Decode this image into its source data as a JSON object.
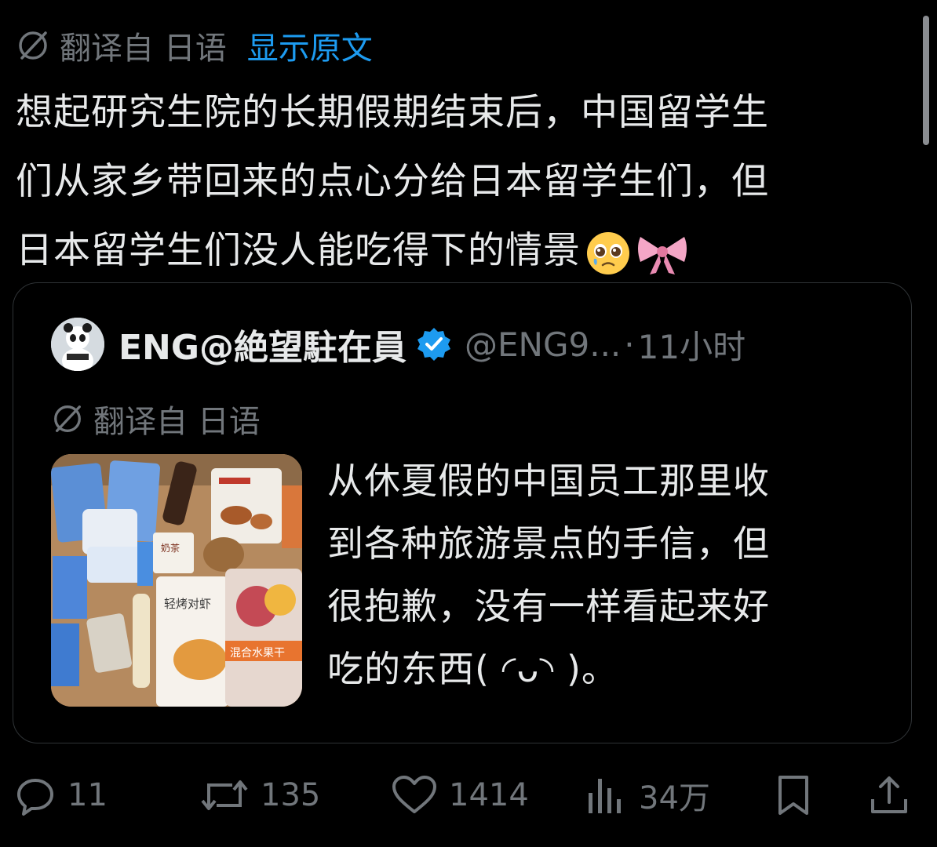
{
  "translation": {
    "label": "翻译自 日语",
    "show_original": "显示原文"
  },
  "tweet": {
    "text_lines": [
      "想起研究生院的长期假期结束后，中国留学生",
      "们从家乡带回来的点心分给日本留学生们，但",
      "日本留学生们没人能吃得下的情景"
    ],
    "emojis": [
      "pleading-face",
      "ribbon-bow"
    ]
  },
  "quote": {
    "author_name": "ENG@絶望駐在員",
    "handle": "@ENG9...",
    "separator": "·",
    "time": "11小时",
    "translation_label": "翻译自 日语",
    "text_lines": [
      "从休夏假的中国员工那里收",
      "到各种旅游景点的手信，但",
      "很抱歉，没有一样看起来好",
      "吃的东西( ◜ᴗ◝ )。"
    ],
    "thumbnail_labels": [
      "轻烤对虾",
      "混合水果干",
      "奶茶"
    ]
  },
  "actions": {
    "reply_count": "11",
    "repost_count": "135",
    "like_count": "1414",
    "view_count": "34万"
  },
  "colors": {
    "background": "#000000",
    "text": "#e7e9ea",
    "muted": "#71767b",
    "link": "#1d9bf0",
    "verified": "#1d9bf0",
    "border": "#2f3336"
  }
}
